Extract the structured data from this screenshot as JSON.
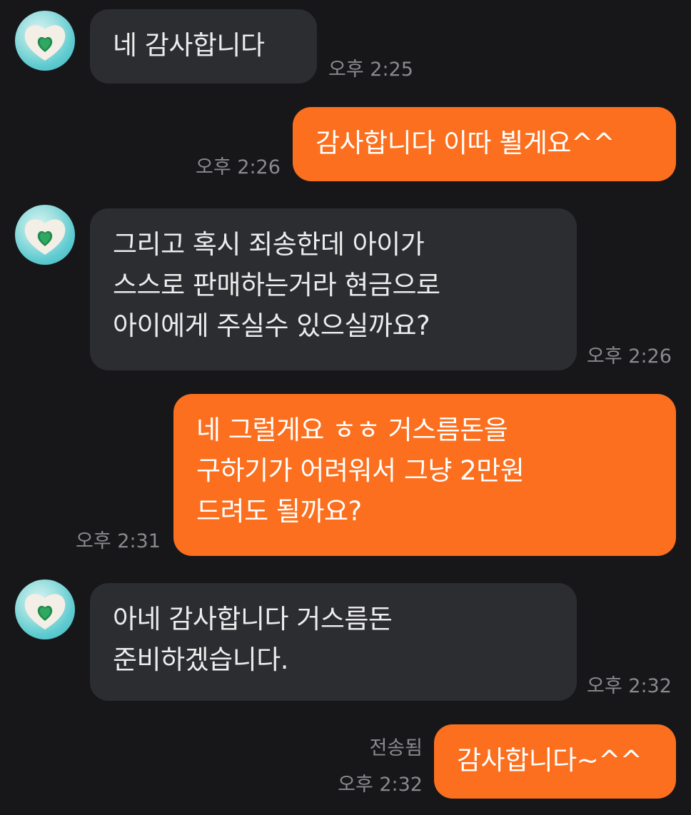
{
  "messages": [
    {
      "direction": "incoming",
      "text": "네 감사합니다",
      "time": "오후 2:25"
    },
    {
      "direction": "outgoing",
      "text": "감사합니다 이따 뵐게요^^",
      "time": "오후 2:26"
    },
    {
      "direction": "incoming",
      "text": "그리고 혹시 죄송한데 아이가\n스스로 판매하는거라 현금으로\n아이에게 주실수 있으실까요?",
      "time": "오후 2:26"
    },
    {
      "direction": "outgoing",
      "text": "네 그럴게요 ㅎㅎ 거스름돈을\n구하기가 어려워서 그냥 2만원\n드려도 될까요?",
      "time": "오후 2:31"
    },
    {
      "direction": "incoming",
      "text": "아네 감사합니다 거스름돈\n준비하겠습니다.",
      "time": "오후 2:32"
    },
    {
      "direction": "outgoing",
      "text": "감사합니다~^^",
      "time": "오후 2:32",
      "status": "전송됨"
    }
  ],
  "colors": {
    "background": "#17171a",
    "incoming_bubble": "#2c2d31",
    "outgoing_bubble": "#fb6f1e",
    "meta_text": "#8a8a8e"
  },
  "icons": {
    "avatar": "heart-avatar-icon"
  }
}
